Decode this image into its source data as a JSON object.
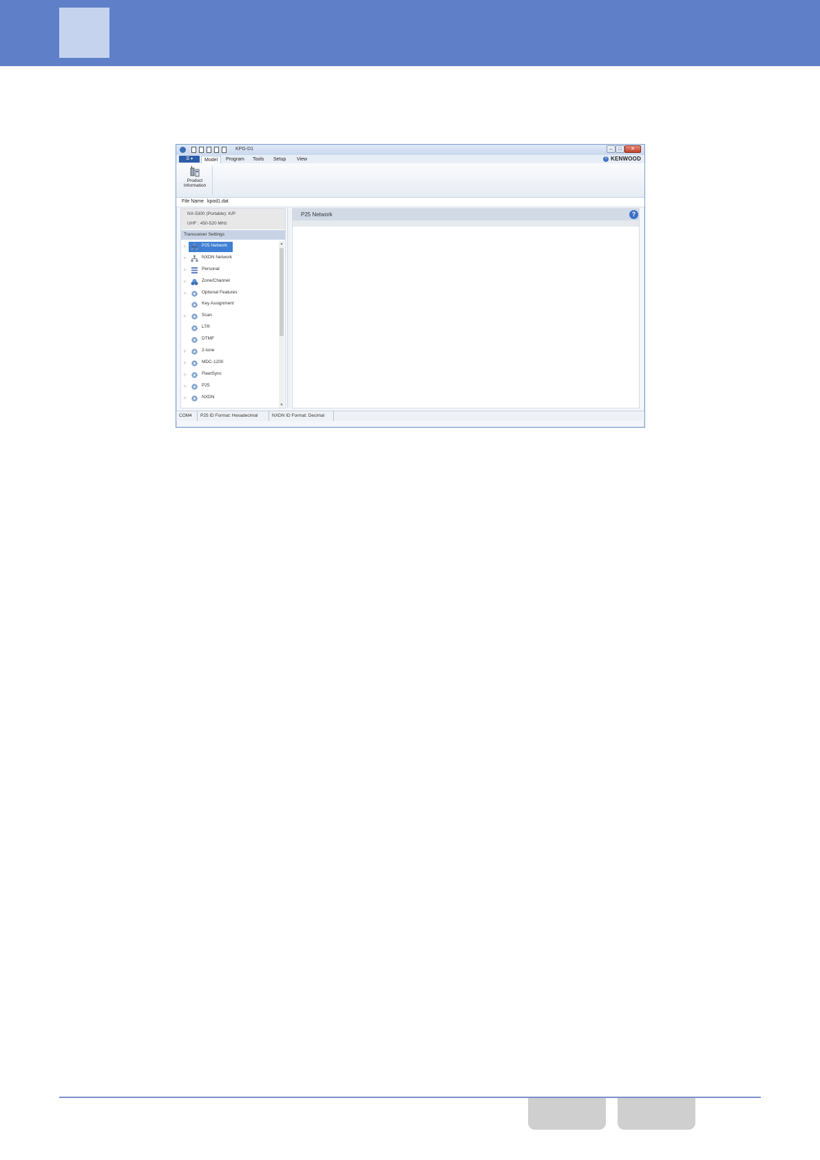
{
  "app": {
    "title": "KPG-D1",
    "menu": {
      "file_button": "☰ ▾",
      "tabs": [
        {
          "label": "Model",
          "active": true
        },
        {
          "label": "Program",
          "active": false
        },
        {
          "label": "Tools",
          "active": false
        },
        {
          "label": "Setup",
          "active": false
        },
        {
          "label": "View",
          "active": false
        }
      ],
      "brand": "KENWOOD",
      "help_glyph": "?"
    },
    "window_buttons": {
      "minimize": "–",
      "maximize": "□",
      "close": "✕"
    },
    "ribbon": {
      "product_info_label_1": "Product",
      "product_info_label_2": "Information"
    },
    "file": {
      "label": "File Name",
      "value": "kpod1.dat"
    },
    "model_info": {
      "line1": "NX-5300 (Portable): K/P",
      "line2": "UHF : 450-520 MHz"
    },
    "tree": {
      "header": "Transceiver Settings",
      "items": [
        {
          "label": "P25 Network",
          "icon": "network-icon",
          "expandable": true,
          "selected": true
        },
        {
          "label": "NXDN Network",
          "icon": "network-icon",
          "expandable": true,
          "selected": false
        },
        {
          "label": "Personal",
          "icon": "list-icon",
          "expandable": true,
          "selected": false
        },
        {
          "label": "Zone/Channel",
          "icon": "zone-icon",
          "expandable": true,
          "selected": false
        },
        {
          "label": "Optional Features",
          "icon": "gear-icon",
          "expandable": true,
          "selected": false
        },
        {
          "label": "Key Assignment",
          "icon": "gear-icon",
          "expandable": false,
          "selected": false
        },
        {
          "label": "Scan",
          "icon": "gear-icon",
          "expandable": true,
          "selected": false
        },
        {
          "label": "LTR",
          "icon": "gear-icon",
          "expandable": false,
          "selected": false
        },
        {
          "label": "DTMF",
          "icon": "gear-icon",
          "expandable": false,
          "selected": false
        },
        {
          "label": "2-tone",
          "icon": "gear-icon",
          "expandable": true,
          "selected": false
        },
        {
          "label": "MDC-1200",
          "icon": "gear-icon",
          "expandable": true,
          "selected": false
        },
        {
          "label": "FleetSync",
          "icon": "gear-icon",
          "expandable": true,
          "selected": false
        },
        {
          "label": "P25",
          "icon": "gear-icon",
          "expandable": true,
          "selected": false
        },
        {
          "label": "NXDN",
          "icon": "gear-icon",
          "expandable": true,
          "selected": false
        }
      ]
    },
    "content": {
      "title": "P25 Network",
      "help_glyph": "?"
    },
    "status": [
      "COM4",
      "P25 ID Format: Hexadecimal",
      "NXDN ID Format: Decimal"
    ]
  },
  "colors": {
    "page_header": "#5f7fc8",
    "header_square": "#c5d3ef",
    "accent": "#3e7fd3"
  }
}
